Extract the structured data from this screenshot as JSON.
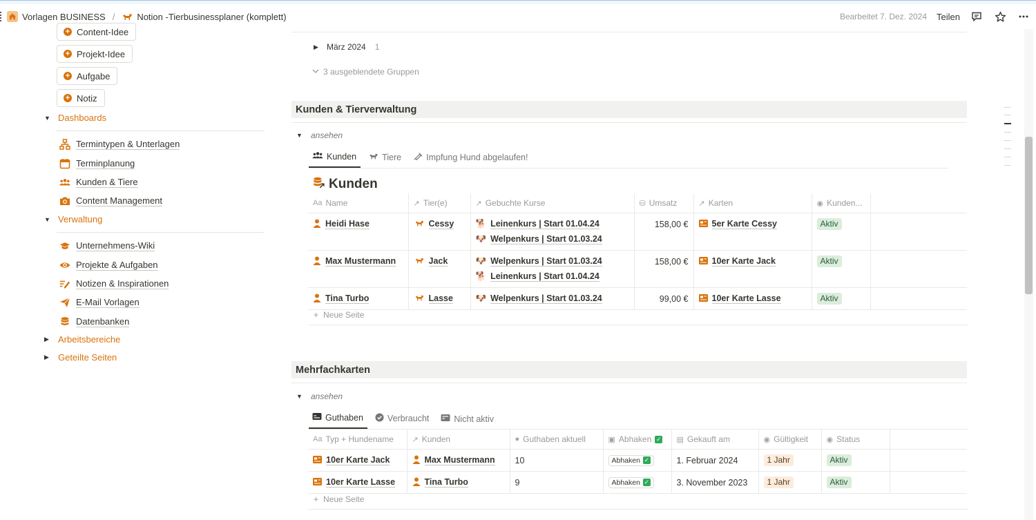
{
  "breadcrumb": {
    "workspace": "Vorlagen BUSINESS",
    "separator": "/",
    "page": "Notion -Tierbusinessplaner (komplett)"
  },
  "topbar": {
    "edited": "Bearbeitet 7. Dez. 2024",
    "share": "Teilen"
  },
  "quick_buttons": [
    "Content-Idee",
    "Projekt-Idee",
    "Aufgabe",
    "Notiz"
  ],
  "sidebar": {
    "dashboards": {
      "label": "Dashboards",
      "items": [
        "Termintypen & Unterlagen",
        "Terminplanung",
        "Kunden & Tiere",
        "Content Management"
      ]
    },
    "verwaltung": {
      "label": "Verwaltung",
      "items": [
        "Unternehmens-Wiki",
        "Projekte & Aufgaben",
        "Notizen & Inspirationen",
        "E-Mail Vorlagen",
        "Datenbanken"
      ]
    },
    "arbeitsbereiche": "Arbeitsbereiche",
    "geteilte": "Geteilte Seiten"
  },
  "groups": {
    "maerz": "März 2024",
    "maerz_count": "1",
    "hidden": "3 ausgeblendete Gruppen"
  },
  "section1": {
    "title": "Kunden & Tierverwaltung",
    "toggle": "ansehen",
    "tabs": [
      "Kunden",
      "Tiere",
      "Impfung Hund abgelaufen!"
    ],
    "db_title": "Kunden",
    "columns": [
      "Name",
      "Tier(e)",
      "Gebuchte Kurse",
      "Umsatz",
      "Karten",
      "Kunden..."
    ],
    "rows": [
      {
        "name": "Heidi Hase",
        "tier": "Cessy",
        "kurse": [
          "Leinenkurs | Start 01.04.24",
          "Welpenkurs | Start 01.03.24"
        ],
        "umsatz": "158,00 €",
        "karte": "5er Karte Cessy",
        "status": "Aktiv"
      },
      {
        "name": "Max Mustermann",
        "tier": "Jack",
        "kurse": [
          "Welpenkurs | Start 01.03.24",
          "Leinenkurs | Start 01.04.24"
        ],
        "umsatz": "158,00 €",
        "karte": "10er Karte Jack",
        "status": "Aktiv"
      },
      {
        "name": "Tina Turbo",
        "tier": "Lasse",
        "kurse": [
          "Welpenkurs | Start 01.03.24"
        ],
        "umsatz": "99,00 €",
        "karte": "10er Karte Lasse",
        "status": "Aktiv"
      }
    ],
    "new_page": "Neue Seite"
  },
  "section2": {
    "title": "Mehrfachkarten",
    "toggle": "ansehen",
    "tabs": [
      "Guthaben",
      "Verbraucht",
      "Nicht aktiv"
    ],
    "columns": [
      "Typ + Hundename",
      "Kunden",
      "Guthaben aktuell",
      "Abhaken",
      "Gekauft am",
      "Gültigkeit",
      "Status"
    ],
    "rows": [
      {
        "typ": "10er Karte Jack",
        "kunde": "Max Mustermann",
        "guthaben": "10",
        "abhaken": "Abhaken",
        "gekauft": "1. Februar 2024",
        "gueltig": "1 Jahr",
        "status": "Aktiv"
      },
      {
        "typ": "10er Karte Lasse",
        "kunde": "Tina Turbo",
        "guthaben": "9",
        "abhaken": "Abhaken",
        "gekauft": "3. November 2023",
        "gueltig": "1 Jahr",
        "status": "Aktiv"
      }
    ],
    "new_page": "Neue Seite"
  },
  "icons": {
    "accent": "#d9730d",
    "status_green": "#dbeddb",
    "status_yellow": "#fbecdd"
  }
}
